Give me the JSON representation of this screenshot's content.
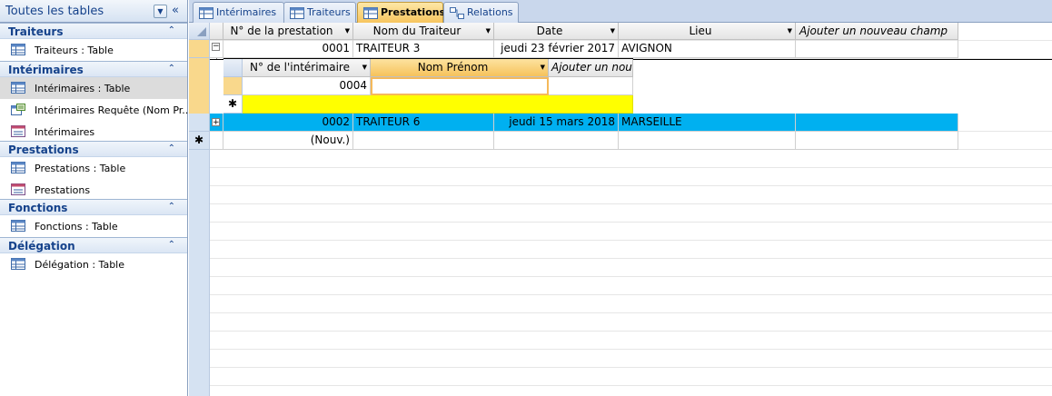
{
  "nav": {
    "title": "Toutes les tables",
    "groups": [
      {
        "name": "Traiteurs",
        "items": [
          {
            "label": "Traiteurs : Table",
            "icon": "table-icon"
          }
        ]
      },
      {
        "name": "Intérimaires",
        "items": [
          {
            "label": "Intérimaires : Table",
            "icon": "table-icon",
            "selected": true
          },
          {
            "label": "Intérimaires Requête (Nom Pr...",
            "icon": "query-icon"
          },
          {
            "label": "Intérimaires",
            "icon": "form-icon"
          }
        ]
      },
      {
        "name": "Prestations",
        "items": [
          {
            "label": "Prestations : Table",
            "icon": "table-icon"
          },
          {
            "label": "Prestations",
            "icon": "form-icon"
          }
        ]
      },
      {
        "name": "Fonctions",
        "items": [
          {
            "label": "Fonctions : Table",
            "icon": "table-icon"
          }
        ]
      },
      {
        "name": "Délégation",
        "items": [
          {
            "label": "Délégation : Table",
            "icon": "table-icon"
          }
        ]
      }
    ]
  },
  "tabs": [
    {
      "label": "Intérimaires",
      "icon": "table-icon"
    },
    {
      "label": "Traiteurs",
      "icon": "table-icon"
    },
    {
      "label": "Prestations",
      "icon": "table-icon",
      "active": true
    },
    {
      "label": "Relations",
      "icon": "relations-icon"
    }
  ],
  "grid": {
    "columns": [
      "N° de la prestation",
      "Nom du Traiteur",
      "Date",
      "Lieu",
      "Ajouter un nouveau champ"
    ],
    "rows": [
      {
        "num": "0001",
        "traiteur": "TRAITEUR 3",
        "date": "jeudi 23 février 2017",
        "lieu": "AVIGNON",
        "expander": "−"
      },
      {
        "num": "0002",
        "traiteur": "TRAITEUR 6",
        "date": "jeudi 15 mars 2018",
        "lieu": "MARSEILLE",
        "expander": "+"
      }
    ],
    "new_row_label": "(Nouv.)",
    "new_row_marker": "✱"
  },
  "subgrid": {
    "columns": [
      "N° de l'intérimaire",
      "Nom Prénom",
      "Ajouter un nou"
    ],
    "rows": [
      {
        "num": "0004",
        "nom": ""
      }
    ],
    "new_row_marker": "✱"
  },
  "colors": {
    "accent": "#15428b",
    "selected_row": "#00b0f0",
    "new_row": "#ffff00",
    "active_tab": "#f7c55e"
  }
}
